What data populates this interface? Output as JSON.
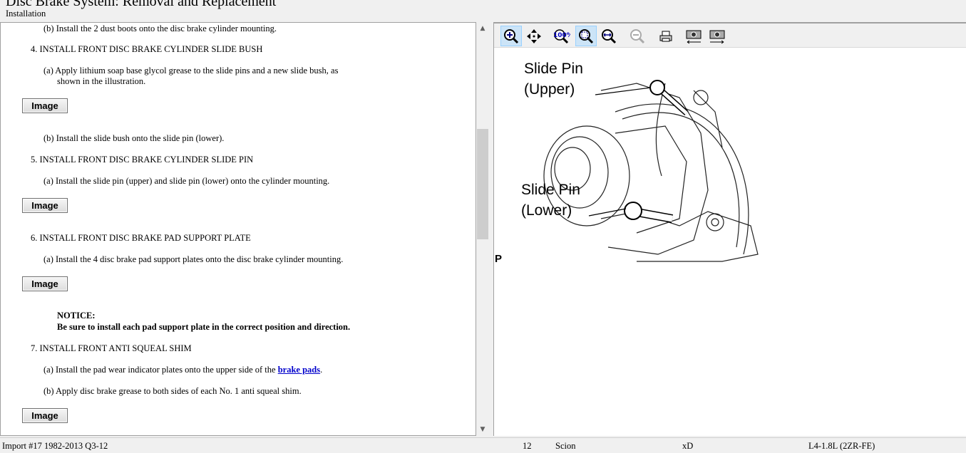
{
  "header": {
    "title": "Disc Brake System:  Removal and Replacement",
    "section": "Installation"
  },
  "content": {
    "l1": "(b) Install the 2 dust boots onto the disc brake cylinder mounting.",
    "s4": "4.   INSTALL FRONT DISC BRAKE CYLINDER SLIDE BUSH",
    "s4a1": "(a) Apply lithium soap base glycol grease to the slide pins and a new slide bush, as",
    "s4a2": "shown in the illustration.",
    "s4b": "(b) Install the slide bush onto the slide pin (lower).",
    "s5": "5.   INSTALL FRONT DISC BRAKE CYLINDER SLIDE PIN",
    "s5a": "(a) Install the slide pin (upper) and slide pin (lower) onto the cylinder mounting.",
    "s6": "6.   INSTALL FRONT DISC BRAKE PAD SUPPORT PLATE",
    "s6a": "(a) Install the 4 disc brake pad support plates onto the disc brake cylinder mounting.",
    "notice_title": "NOTICE:",
    "notice_text": "Be sure to install each pad support plate in the correct position and direction.",
    "s7": "7.   INSTALL FRONT ANTI SQUEAL SHIM",
    "s7a_pre": "(a) Install the pad wear indicator plates onto the upper side of the ",
    "s7a_link": "brake pads",
    "s7a_post": ".",
    "s7b": "(b) Apply disc brake grease to both sides of each No. 1 anti squeal shim.",
    "image_button": "Image"
  },
  "toolbar": {
    "items": [
      "zoom-in",
      "pan",
      "zoom-100",
      "zoom-fit",
      "zoom-width",
      "zoom-out",
      "print",
      "previous-image",
      "next-image"
    ]
  },
  "illustration": {
    "label_upper_1": "Slide Pin",
    "label_upper_2": "(Upper)",
    "label_lower_1": "Slide Pin",
    "label_lower_2": "(Lower)",
    "marker": "P"
  },
  "status": {
    "import": "Import #17 1982-2013 Q3-12",
    "year": "12",
    "make": "Scion",
    "model": "xD",
    "engine": "L4-1.8L (2ZR-FE)"
  }
}
